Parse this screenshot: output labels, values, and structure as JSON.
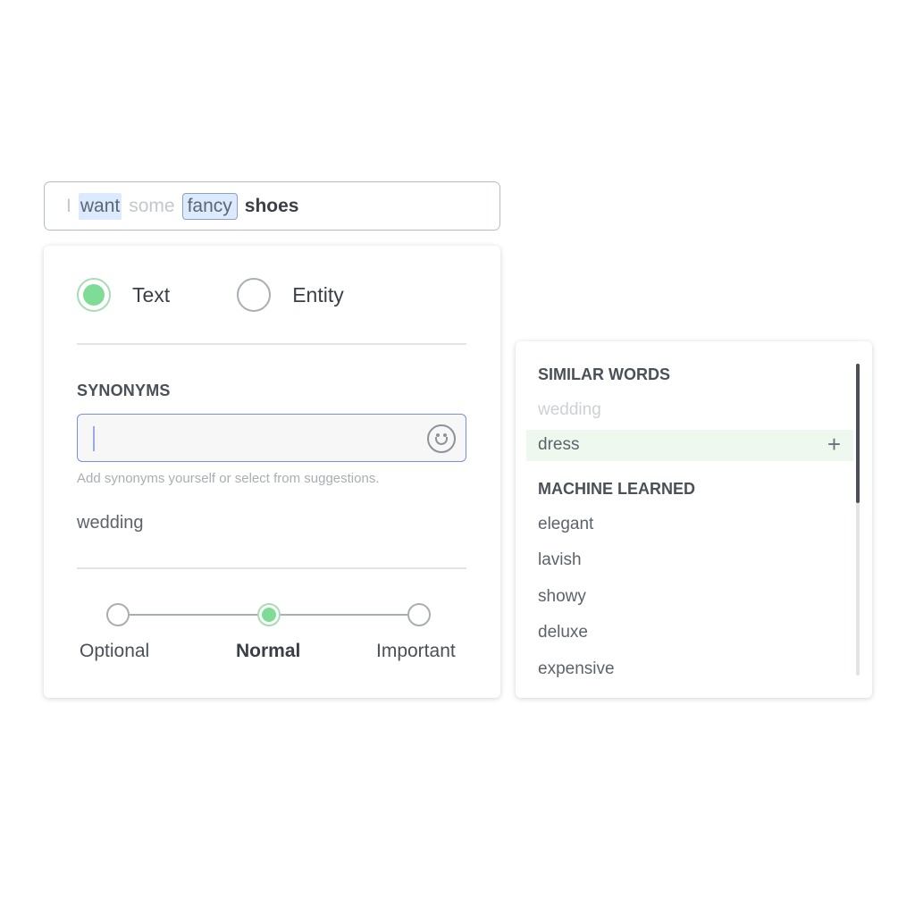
{
  "query": {
    "tokens": [
      "I",
      "want",
      "some",
      "fancy",
      "shoes"
    ]
  },
  "mode": {
    "options": [
      "Text",
      "Entity"
    ],
    "selected": "Text"
  },
  "synonyms": {
    "title": "SYNONYMS",
    "input_value": "",
    "hint": "Add synonyms yourself or select from suggestions.",
    "items": [
      "wedding"
    ]
  },
  "priority": {
    "levels": [
      "Optional",
      "Normal",
      "Important"
    ],
    "selected": "Normal"
  },
  "suggestions": {
    "similar_title": "SIMILAR WORDS",
    "similar_words": [
      "wedding",
      "dress"
    ],
    "ml_title": "MACHINE LEARNED",
    "ml_words": [
      "elegant",
      "lavish",
      "showy",
      "deluxe",
      "expensive"
    ],
    "add_symbol": "+"
  },
  "colors": {
    "accent_green": "#7fdc96",
    "focus_blue": "#7b8fe0",
    "token_highlight": "#dbeafe"
  }
}
